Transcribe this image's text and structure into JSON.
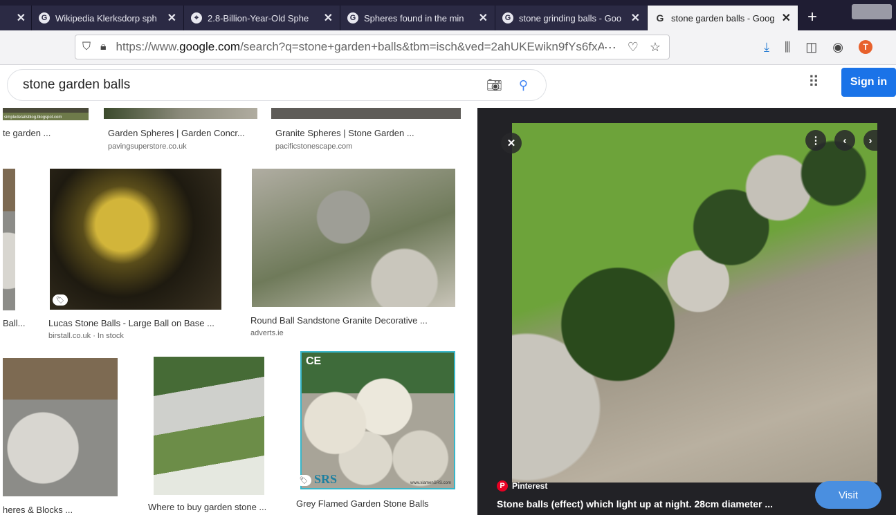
{
  "tabs": [
    {
      "label": "Wikipedia Klerksdorp sph",
      "favicon": "G"
    },
    {
      "label": "2.8-Billion-Year-Old Sphe",
      "favicon": "⌖"
    },
    {
      "label": "Spheres found in the min",
      "favicon": "G"
    },
    {
      "label": "stone grinding balls - Goo",
      "favicon": "G"
    },
    {
      "label": "stone garden balls - Goog",
      "favicon": "G"
    }
  ],
  "new_tab_label": "+",
  "address": {
    "url_prefix": "https://www.",
    "url_domain": "google.com",
    "url_rest": "/search?q=stone+garden+balls&tbm=isch&ved=2ahUKEwikn9fYs6fxA",
    "more": "···"
  },
  "search": {
    "query": "stone garden balls"
  },
  "header": {
    "signin": "Sign in",
    "apps_icon": "apps-grid-icon"
  },
  "results": {
    "row1": [
      {
        "title": "te garden ...",
        "source": ""
      },
      {
        "title": "Garden Spheres | Garden Concr...",
        "source": "pavingsuperstore.co.uk"
      },
      {
        "title": "Granite Spheres | Stone Garden ...",
        "source": "pacificstonescape.com"
      }
    ],
    "row1_banner": "simpledetailsblog.blogspot.com",
    "row2": [
      {
        "title": "Ball...",
        "source": ""
      },
      {
        "title": "Lucas Stone Balls - Large Ball on Base ...",
        "source": "birstall.co.uk · In stock"
      },
      {
        "title": "Round Ball Sandstone Granite Decorative ...",
        "source": "adverts.ie"
      }
    ],
    "row3": [
      {
        "title": "heres & Blocks ...",
        "source": ""
      },
      {
        "title": "Where to buy garden stone ...",
        "source": ""
      },
      {
        "title": "Grey Flamed Garden Stone Balls",
        "source": ""
      }
    ],
    "srs_logo": "SRS",
    "srs_ce": "CE",
    "srs_url": "www.xiamenSRS.com"
  },
  "preview": {
    "source": "Pinterest",
    "title": "Stone balls (effect) which light up at night. 28cm diameter ...",
    "visit": "Visit",
    "close": "✕",
    "more": "⋮",
    "prev": "‹",
    "next": "›"
  },
  "colors": {
    "accent": "#1a73e8",
    "tabbar": "#1f1d33",
    "pinterest": "#e60023"
  }
}
